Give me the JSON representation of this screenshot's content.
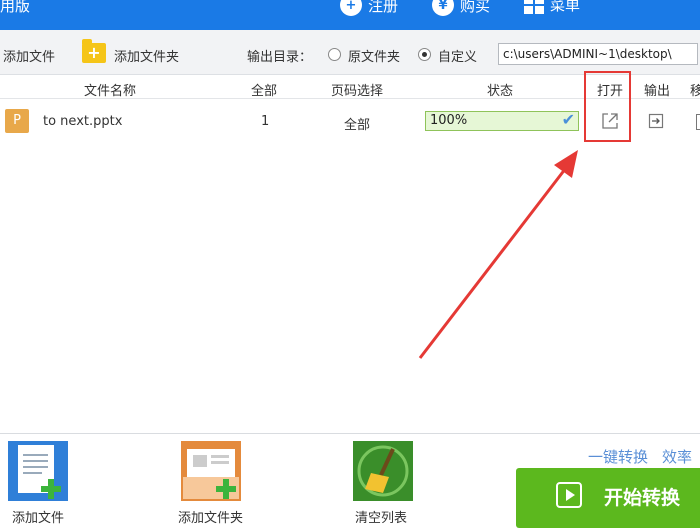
{
  "titlebar": {
    "title_fragment": "用版",
    "register_label": "注册",
    "buy_label": "购买",
    "menu_label": "菜单",
    "bg_color": "#1a7ae6"
  },
  "toolbar": {
    "add_file_label": "添加文件",
    "add_folder_label": "添加文件夹",
    "output_dir_label": "输出目录：",
    "radio_original_label": "原文件夹",
    "radio_custom_label": "自定义",
    "selected_radio": "custom",
    "path_value": "c:\\users\\ADMINI~1\\desktop\\"
  },
  "table": {
    "headers": {
      "filename": "文件名称",
      "all": "全部",
      "page_select": "页码选择",
      "status": "状态",
      "open": "打开",
      "export": "输出",
      "delete": "移"
    },
    "rows": [
      {
        "type_icon": "P",
        "filename": "to next.pptx",
        "all": "1",
        "page_select": "全部",
        "progress_text": "100%",
        "progress": 1.0
      }
    ]
  },
  "icons": {
    "register": "user-add-icon",
    "buy": "yen-icon",
    "menu": "grid-menu-icon",
    "open": "external-open-icon",
    "export": "export-arrow-icon",
    "delete": "trash-icon"
  },
  "bottom": {
    "slogan_1": "一键转换",
    "slogan_2": "效率提",
    "start_label": "开始转换",
    "add_file_big_label": "添加文件",
    "add_folder_big_label": "添加文件夹",
    "clear_list_label": "清空列表",
    "start_color": "#5cb81e"
  },
  "annotation": {
    "highlight_color": "#e53935"
  }
}
